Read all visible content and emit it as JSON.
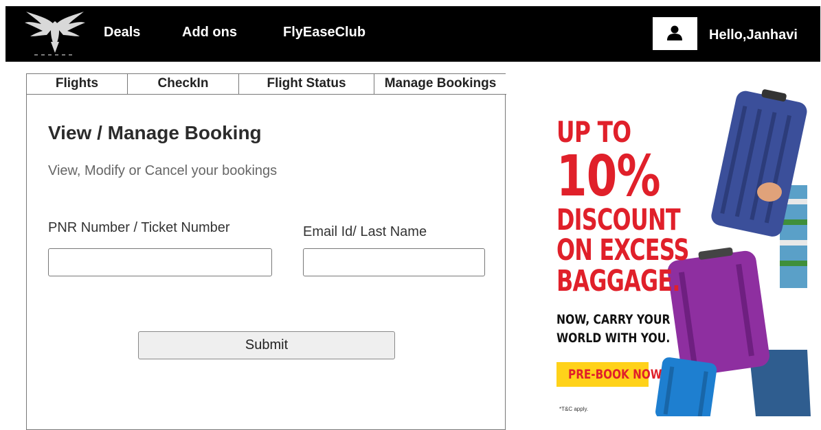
{
  "nav": {
    "links": [
      "Deals",
      "Add ons",
      "FlyEaseClub"
    ],
    "greeting": "Hello,Janhavi",
    "logo_icon": "eagle-logo-icon",
    "user_icon": "user-icon"
  },
  "tabs": [
    "Flights",
    "CheckIn",
    "Flight Status",
    "Manage Bookings"
  ],
  "booking": {
    "title": "View / Manage Booking",
    "subtitle": "View, Modify or Cancel your bookings",
    "pnr_label": "PNR Number / Ticket Number",
    "pnr_value": "",
    "email_label": "Email Id/ Last Name",
    "email_value": "",
    "submit_label": "Submit"
  },
  "promo": {
    "line1": "UP TO",
    "line2": "10%",
    "line3": "DISCOUNT",
    "line4": "ON EXCESS",
    "line5": "BAGGAGE.",
    "tagline1": "NOW, CARRY YOUR",
    "tagline2": "WORLD WITH YOU.",
    "cta": "PRE-BOOK NOW",
    "tnc": "*T&C apply."
  },
  "colors": {
    "nav_bg": "#000000",
    "promo_red": "#e0202a",
    "promo_yellow": "#ffd21a"
  }
}
